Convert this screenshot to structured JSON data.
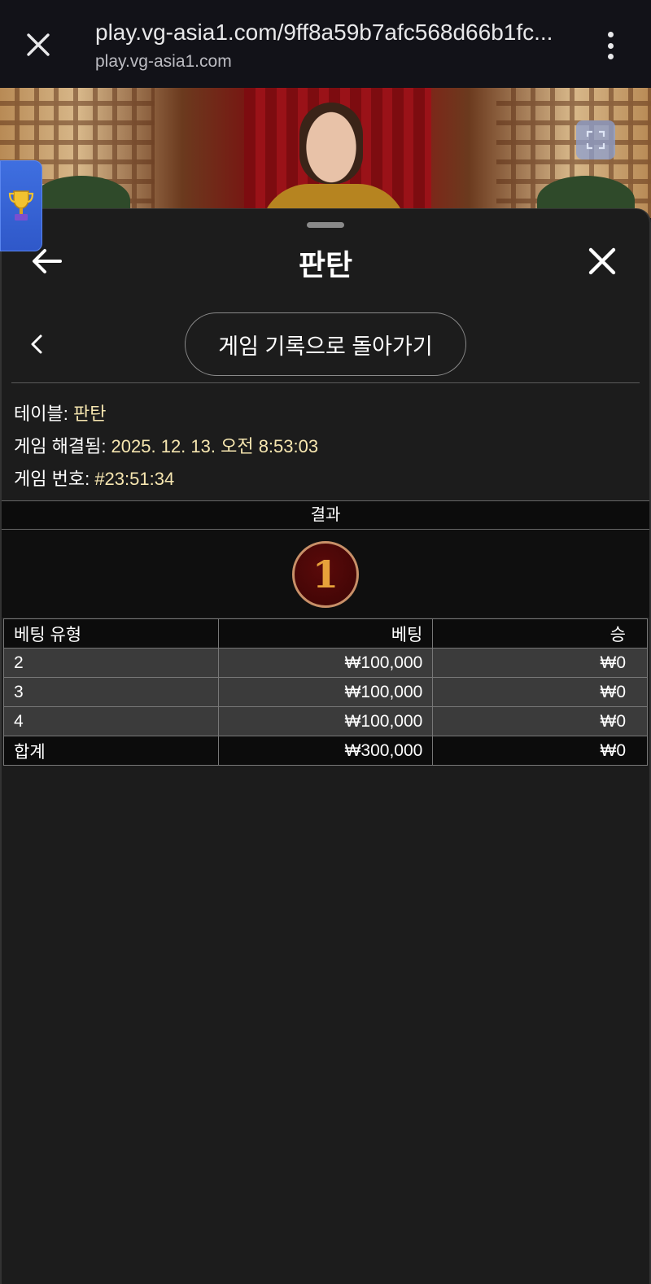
{
  "browser": {
    "url": "play.vg-asia1.com/9ff8a59b7afc568d66b1fc...",
    "domain": "play.vg-asia1.com"
  },
  "sheet": {
    "title": "판탄",
    "history_button": "게임 기록으로 돌아가기"
  },
  "info": {
    "table_label": "테이블: ",
    "table_value": "판탄",
    "resolved_label": "게임 해결됨: ",
    "resolved_value": "2025. 12. 13. 오전 8:53:03",
    "game_no_label": "게임 번호: ",
    "game_no_value": "#23:51:34"
  },
  "result": {
    "header": "결과",
    "value": "1"
  },
  "bets": {
    "columns": [
      "베팅 유형",
      "베팅",
      "승"
    ],
    "rows": [
      {
        "type": "2",
        "bet": "₩100,000",
        "win": "₩0"
      },
      {
        "type": "3",
        "bet": "₩100,000",
        "win": "₩0"
      },
      {
        "type": "4",
        "bet": "₩100,000",
        "win": "₩0"
      }
    ],
    "total": {
      "type": "합계",
      "bet": "₩300,000",
      "win": "₩0"
    }
  },
  "icons": {
    "close": "close-icon",
    "menu": "more-vert-icon",
    "expand": "expand-icon",
    "trophy": "trophy-icon",
    "back": "arrow-left-icon",
    "chevron": "chevron-left-icon"
  },
  "colors": {
    "accent_value": "#f6e6b0",
    "trophy_tab": "#3f6fe0"
  }
}
